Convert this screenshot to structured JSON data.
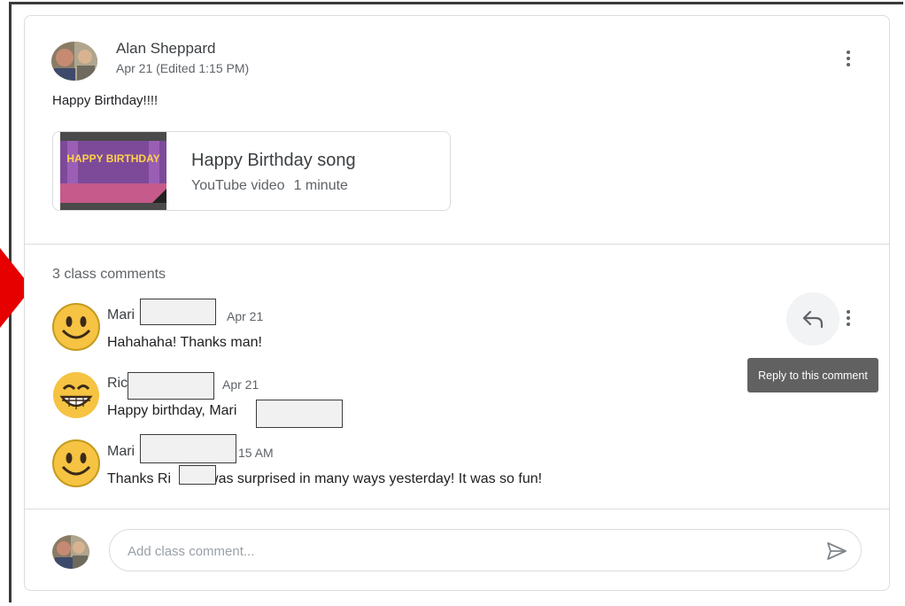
{
  "post": {
    "author": "Alan Sheppard",
    "date": "Apr 21 (Edited 1:15 PM)",
    "text": "Happy Birthday!!!!",
    "attachment": {
      "title": "Happy Birthday song",
      "type": "YouTube video",
      "duration": "1 minute",
      "thumbnail_text": "HAPPY BIRTHDAY"
    }
  },
  "comments_header": "3 class comments",
  "comments": [
    {
      "name": "Mari",
      "date": "Apr 21",
      "text": "Hahahaha! Thanks man!",
      "avatar_icon": "smiley-icon"
    },
    {
      "name": "Ric",
      "date": "Apr 21",
      "text": "Happy birthday, Mari",
      "avatar_icon": "grin-icon"
    },
    {
      "name": "Mari",
      "date": "15 AM",
      "text_before": "Thanks Ri",
      "text_after": "was surprised in many ways yesterday! It was so fun!",
      "avatar_icon": "smiley-icon"
    }
  ],
  "reply_tooltip": "Reply to this comment",
  "comment_input": {
    "placeholder": "Add class comment...",
    "value": ""
  },
  "colors": {
    "accent_red": "#e60000",
    "border": "#dadce0",
    "tooltip_bg": "#616161"
  }
}
